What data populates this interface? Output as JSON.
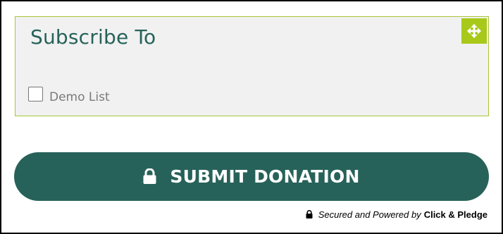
{
  "subscribe": {
    "title": "Subscribe To",
    "options": [
      {
        "label": "Demo List",
        "checked": false
      }
    ]
  },
  "submit": {
    "label": "SUBMIT DONATION"
  },
  "footer": {
    "secured_text": "Secured and Powered by",
    "brand": "Click & Pledge"
  },
  "icons": {
    "move": "move-arrows-icon",
    "submit": "lock-icon",
    "footer": "lock-icon"
  },
  "colors": {
    "primary": "#27625a",
    "accent": "#a8c91a",
    "panel_background": "#f1f1f1",
    "panel_border": "#a8c637"
  }
}
